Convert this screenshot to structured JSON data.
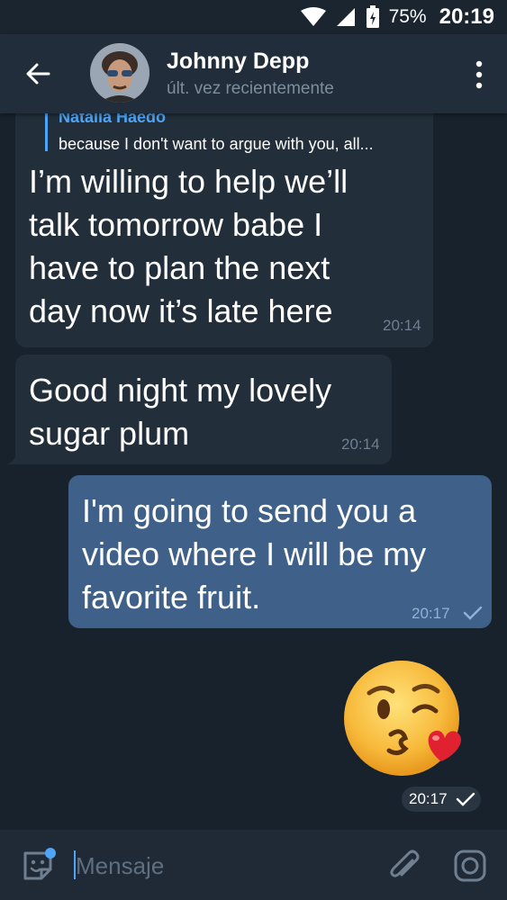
{
  "status_bar": {
    "battery_percent": "75%",
    "time": "20:19",
    "icons": [
      "wifi-icon",
      "signal-icon",
      "battery-icon"
    ]
  },
  "header": {
    "contact_name": "Johnny Depp",
    "contact_status": "últ. vez recientemente",
    "icons": [
      "back-arrow-icon",
      "avatar",
      "more-vert-icon"
    ]
  },
  "messages": [
    {
      "direction": "incoming",
      "reply_to": {
        "name": "Natalia Haedo",
        "text": "because I don't want to argue with you, all..."
      },
      "lines": [
        "I’m willing to help we’ll",
        "talk tomorrow babe I",
        "have to plan the next",
        "day now it’s late here"
      ],
      "time": "20:14"
    },
    {
      "direction": "incoming",
      "lines": [
        "Good night my lovely",
        "sugar plum"
      ],
      "time": "20:14"
    },
    {
      "direction": "outgoing",
      "lines": [
        "I'm going to send you a",
        "video where I will be my",
        "favorite fruit."
      ],
      "time": "20:17",
      "status_icon": "check-icon"
    },
    {
      "direction": "outgoing",
      "sticker": "kissing-heart-emoji",
      "time": "20:17",
      "status_icon": "check-icon"
    }
  ],
  "input_bar": {
    "placeholder": "Mensaje",
    "icons": [
      "sticker-emoji-icon",
      "paperclip-icon",
      "camera-icon"
    ]
  },
  "colors": {
    "background": "#18222d",
    "header": "#212d3b",
    "incoming_bubble": "#222e3a",
    "outgoing_bubble": "#3f6189",
    "accent": "#4ea4f6"
  }
}
